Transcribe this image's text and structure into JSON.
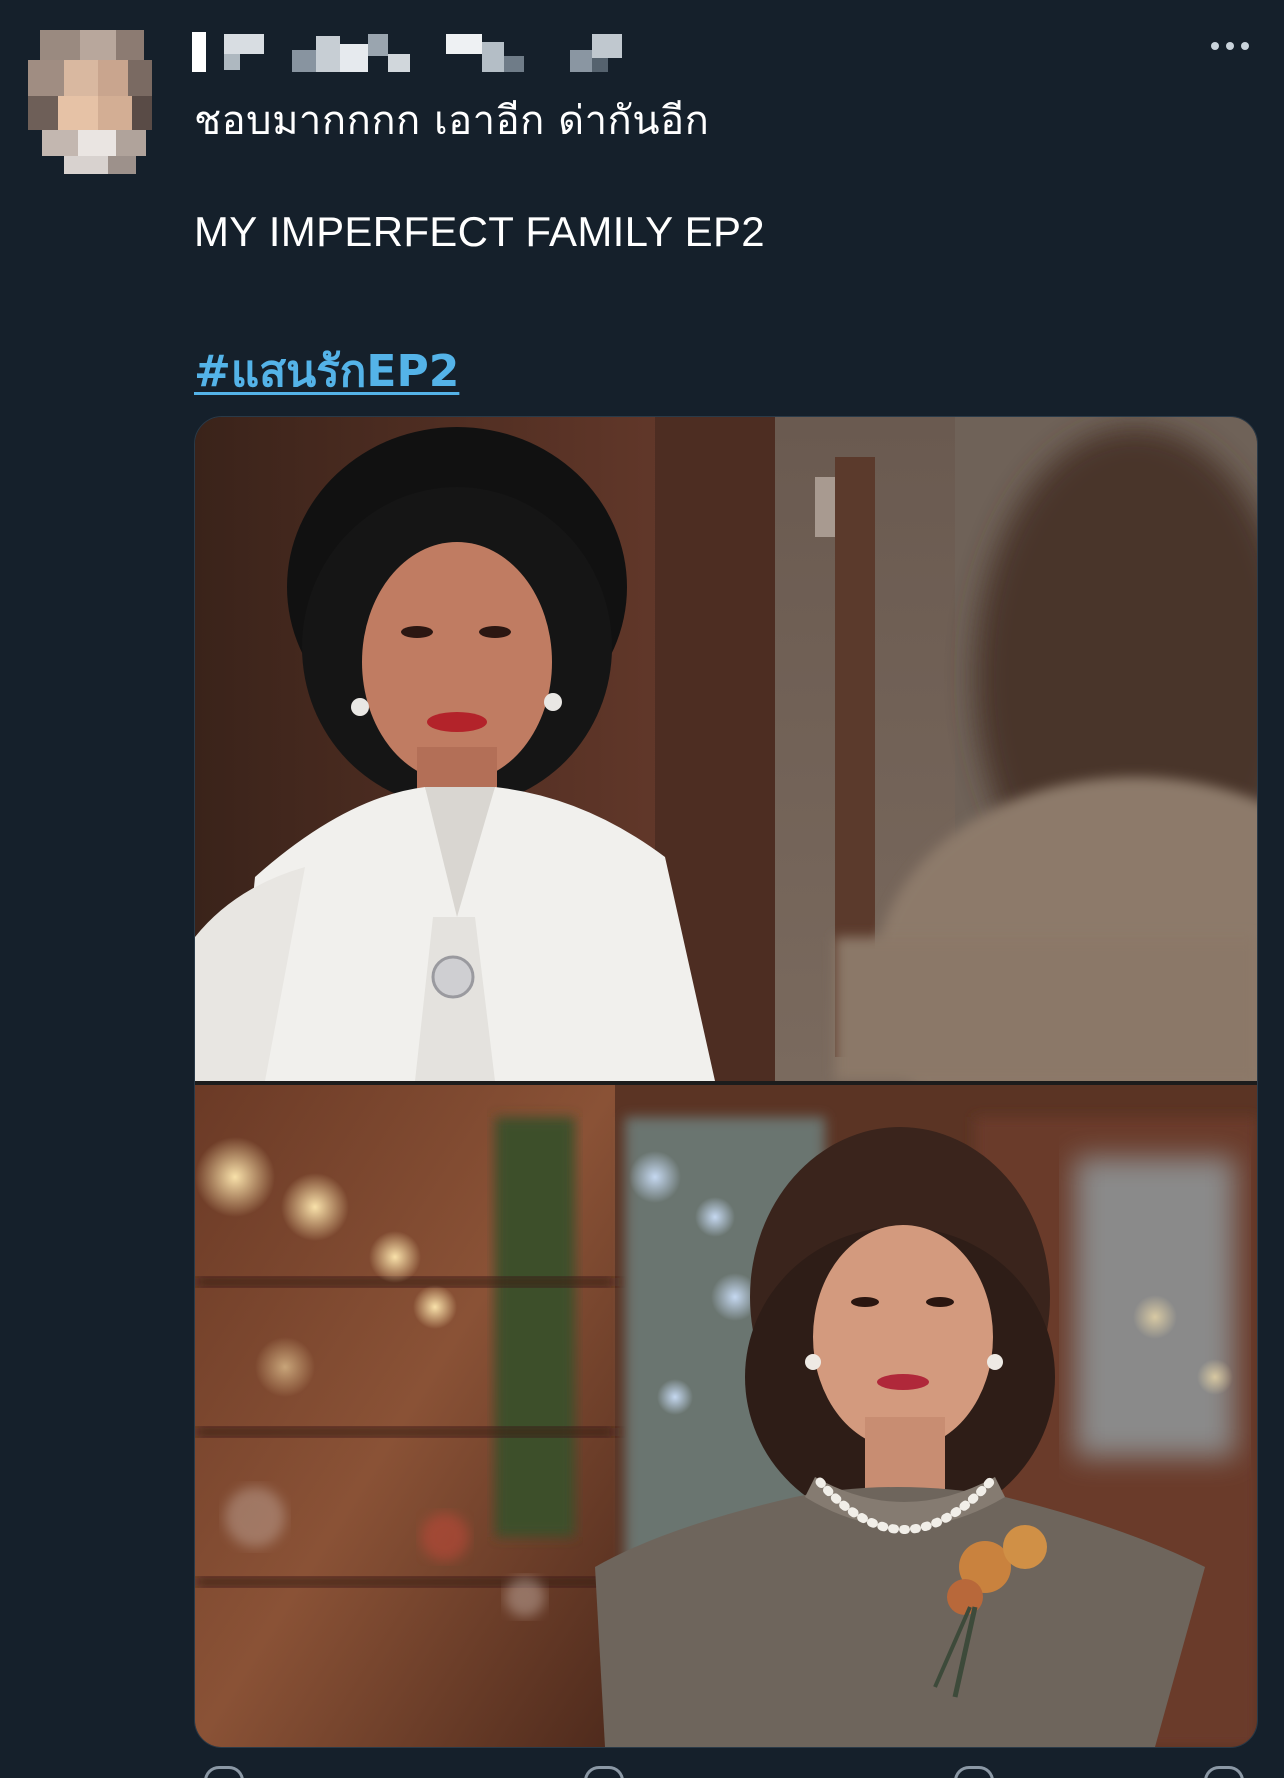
{
  "tweet": {
    "author": {
      "avatar_icon": "pixelated-avatar-icon",
      "name_redacted": true
    },
    "more_icon": "more-options-icon",
    "text_line1": "ชอบมากกกก เอาอีก ด่ากันอีก",
    "text_line2": "MY IMPERFECT FAMILY EP2",
    "hashtag": "#แสนรักEP2",
    "media": {
      "count": 2,
      "images": [
        {
          "icon": "photo-woman-white-blouse"
        },
        {
          "icon": "photo-woman-grey-dress-pearls"
        }
      ]
    },
    "actions": [
      "reply-icon",
      "retweet-icon",
      "like-icon",
      "share-icon"
    ]
  },
  "colors": {
    "background": "#15202b",
    "text": "#ffffff",
    "link": "#54b3e8",
    "muted": "#8b98a5"
  }
}
